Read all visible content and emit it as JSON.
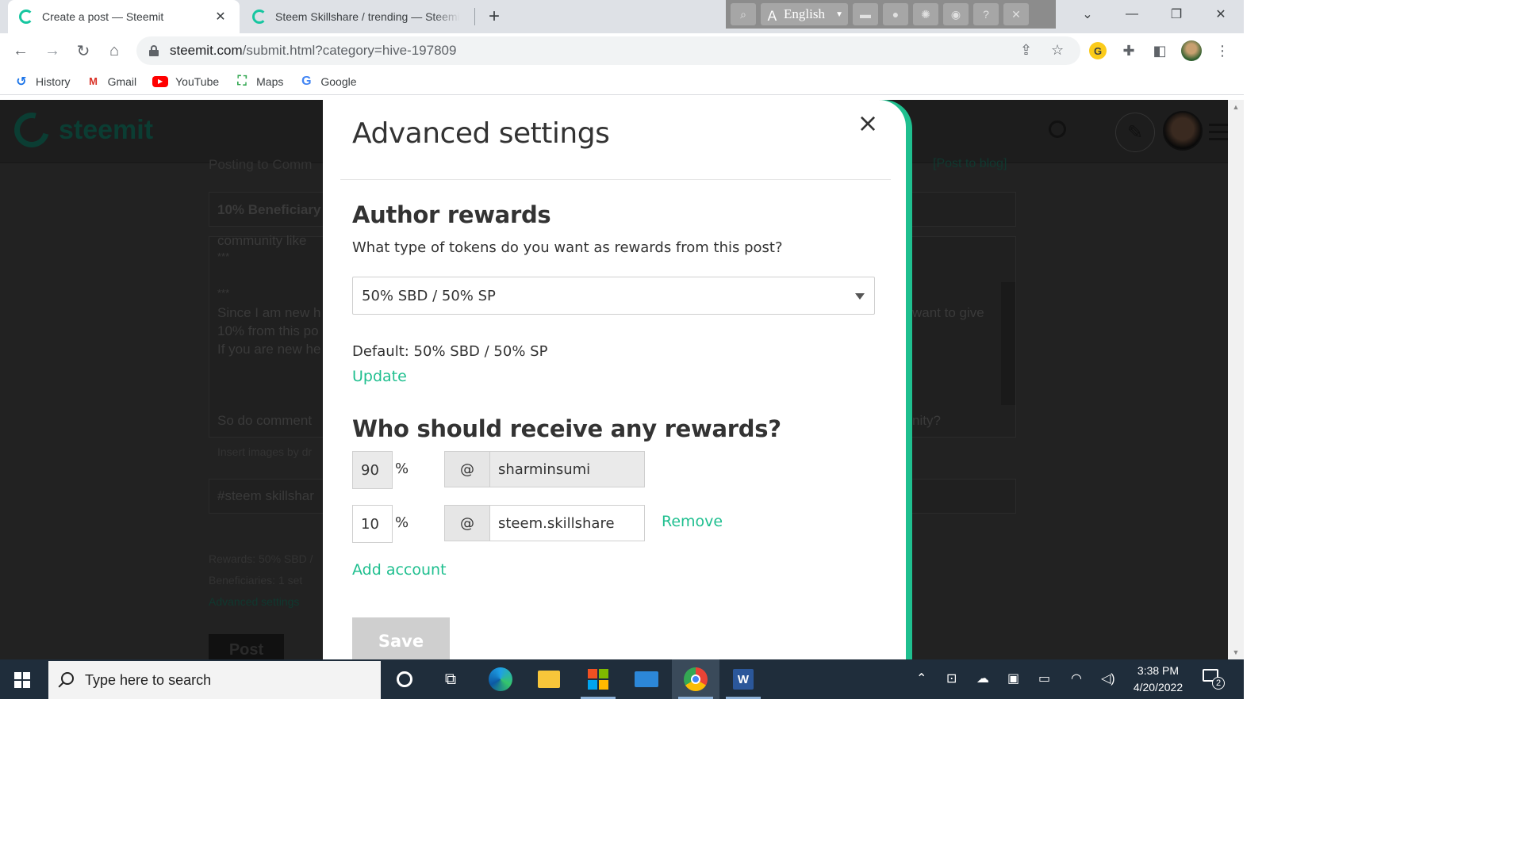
{
  "browser": {
    "tabs": [
      {
        "title": "Create a post — Steemit",
        "active": true
      },
      {
        "title": "Steem Skillshare / trending — Steemit",
        "active": false
      }
    ],
    "extension_toolbar": {
      "language": "English"
    },
    "url": {
      "host": "steemit.com",
      "path": "/submit.html?category=hive-197809"
    },
    "bookmarks": [
      {
        "label": "History",
        "icon": "history-icon"
      },
      {
        "label": "Gmail",
        "icon": "gmail-icon"
      },
      {
        "label": "YouTube",
        "icon": "youtube-icon"
      },
      {
        "label": "Maps",
        "icon": "maps-icon"
      },
      {
        "label": "Google",
        "icon": "google-icon"
      }
    ],
    "extension_badge": "G"
  },
  "background_page": {
    "logo_text": "steemit",
    "posting_to": "Posting to Comm",
    "post_to_blog": "[Post to blog]",
    "title_field": "10% Beneficiary",
    "body_lines": [
      "community like",
      "***",
      "***",
      "Since I am new h",
      "10% from this po",
      "If you are new he",
      "So do comment"
    ],
    "body_right_1": "want to give",
    "body_right_2": "nity?",
    "insert_images": "Insert images by dr",
    "tags_field": "#steem skillshar",
    "rewards_summary": "Rewards: 50% SBD /",
    "beneficiaries_summary": "Beneficiaries: 1 set",
    "advanced_settings_link": "Advanced settings",
    "post_button": "Post"
  },
  "modal": {
    "title": "Advanced settings",
    "author_rewards": {
      "heading": "Author rewards",
      "question": "What type of tokens do you want as rewards from this post?",
      "selected": "50% SBD / 50% SP",
      "default_text": "Default: 50% SBD / 50% SP",
      "update_link": "Update"
    },
    "beneficiaries": {
      "heading": "Who should receive any rewards?",
      "rows": [
        {
          "percent": "90",
          "percent_sign": "%",
          "at": "@",
          "account": "sharminsumi",
          "readonly": true
        },
        {
          "percent": "10",
          "percent_sign": "%",
          "at": "@",
          "account": "steem.skillshare",
          "readonly": false,
          "remove_label": "Remove"
        }
      ],
      "add_account": "Add account"
    },
    "save_label": "Save"
  },
  "taskbar": {
    "search_placeholder": "Type here to search",
    "time": "3:38 PM",
    "date": "4/20/2022",
    "notification_count": "2"
  }
}
